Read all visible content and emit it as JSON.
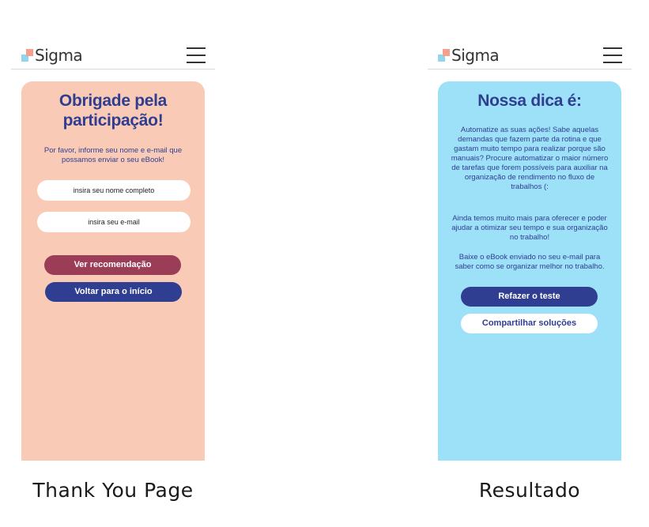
{
  "brand": {
    "name": "Sigma",
    "colors": {
      "peach": "#f9cbb6",
      "blue": "#9de1f8",
      "navy": "#2f3e91",
      "wine": "#9b3d56"
    }
  },
  "thank_you": {
    "title": "Obrigade pela participação!",
    "subtitle": "Por favor, informe seu nome e e-mail que possamos enviar o seu eBook!",
    "name_placeholder": "insira seu nome completo",
    "email_placeholder": "insira seu e-mail",
    "recommend_button": "Ver recomendação",
    "back_button": "Voltar para o início",
    "caption": "Thank You Page"
  },
  "result": {
    "title": "Nossa dica é:",
    "paragraph1": "Automatize as suas ações! Sabe aquelas demandas que fazem parte da rotina e que gastam muito tempo para realizar porque são manuais? Procure automatizar o maior número de tarefas que forem possíveis para auxiliar na organização de rendimento no fluxo de trabalhos (:",
    "paragraph2": "Ainda temos muito mais para oferecer e poder ajudar a otimizar seu tempo e sua organização no trabalho!",
    "paragraph3": "Baixe o eBook enviado no seu e-mail para saber como se organizar melhor no trabalho.",
    "retake_button": "Refazer o teste",
    "share_button": "Compartilhar soluções",
    "caption": "Resultado"
  },
  "icons": {
    "menu": "hamburger-icon"
  }
}
